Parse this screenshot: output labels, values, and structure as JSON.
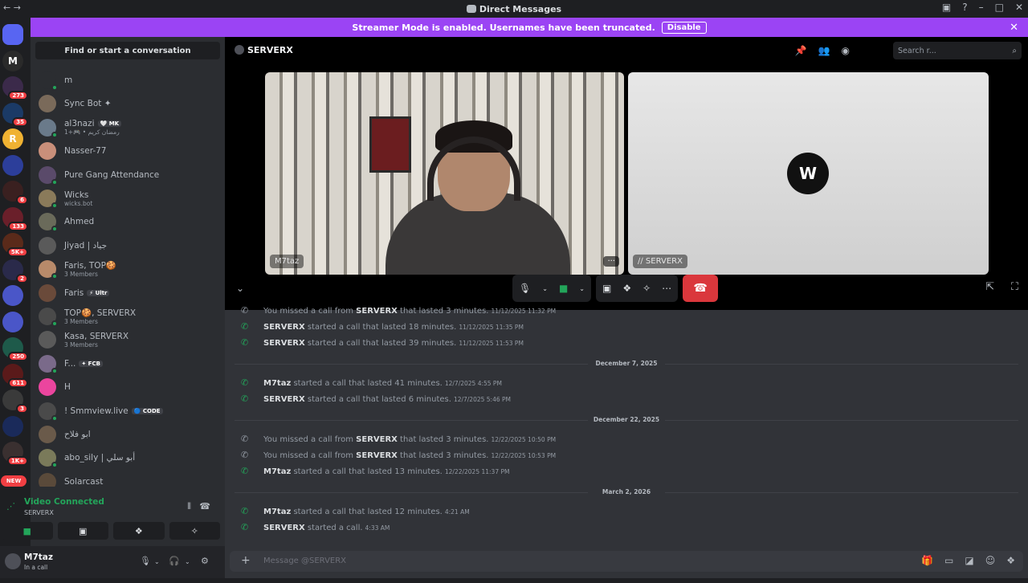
{
  "window": {
    "title": "Direct Messages",
    "nav_glyph": "← →",
    "controls": [
      "▣",
      "?",
      "–",
      "□",
      "✕"
    ]
  },
  "banner": {
    "text": "Streamer Mode is enabled. Usernames have been truncated.",
    "button": "Disable",
    "close": "✕"
  },
  "guilds": [
    {
      "glyph": "",
      "badge": "",
      "home": true
    },
    {
      "glyph": "M",
      "badge": ""
    },
    {
      "glyph": "",
      "badge": "273"
    },
    {
      "glyph": "",
      "badge": "35"
    },
    {
      "glyph": "R",
      "badge": ""
    },
    {
      "glyph": "",
      "badge": ""
    },
    {
      "glyph": "",
      "badge": "6"
    },
    {
      "glyph": "",
      "badge": "133"
    },
    {
      "glyph": "",
      "badge": "5K+"
    },
    {
      "glyph": "",
      "badge": "2"
    },
    {
      "glyph": "",
      "badge": ""
    },
    {
      "glyph": "",
      "badge": ""
    },
    {
      "glyph": "",
      "badge": "250"
    },
    {
      "glyph": "",
      "badge": "611"
    },
    {
      "glyph": "",
      "badge": "3"
    },
    {
      "glyph": "",
      "badge": ""
    },
    {
      "glyph": "",
      "badge": "1K+"
    }
  ],
  "guild_new_label": "NEW",
  "sidebar": {
    "find_label": "Find or start a conversation",
    "dms": [
      {
        "name": "m",
        "sub": "",
        "tag": ""
      },
      {
        "name": "Sync Bot ✦",
        "sub": "",
        "tag": ""
      },
      {
        "name": "al3nazi",
        "sub": "رمضان كريم • 🎮+1",
        "tag": "🤍 MK"
      },
      {
        "name": "Nasser-77",
        "sub": "",
        "tag": ""
      },
      {
        "name": "Pure Gang Attendance",
        "sub": "",
        "tag": ""
      },
      {
        "name": "Wicks",
        "sub": "wicks.bot",
        "tag": ""
      },
      {
        "name": "Ahmed",
        "sub": "",
        "tag": ""
      },
      {
        "name": "Jiyad | جياد",
        "sub": "",
        "tag": ""
      },
      {
        "name": "Faris, TOP🍪",
        "sub": "3 Members",
        "tag": ""
      },
      {
        "name": "Faris",
        "sub": "",
        "tag": "⚡ Ultr"
      },
      {
        "name": "TOP🍪, SERVERX",
        "sub": "3 Members",
        "tag": ""
      },
      {
        "name": "Kasa, SERVERX",
        "sub": "3 Members",
        "tag": ""
      },
      {
        "name": "F...",
        "sub": "",
        "tag": "✦ FCB"
      },
      {
        "name": "H",
        "sub": "",
        "tag": ""
      },
      {
        "name": "! Smmview.live",
        "sub": "",
        "tag": "🔵 CODE"
      },
      {
        "name": "ابو فلاح",
        "sub": "",
        "tag": ""
      },
      {
        "name": "abo_sily | أبو سلي",
        "sub": "",
        "tag": ""
      },
      {
        "name": "Solarcast",
        "sub": "",
        "tag": ""
      }
    ]
  },
  "voice": {
    "status": "Video Connected",
    "channel": "SERVERX",
    "buttons": [
      "■",
      "▣",
      "❖",
      "✧"
    ]
  },
  "user": {
    "name": "M7taz",
    "status": "In a call"
  },
  "call": {
    "header": "SERVERX",
    "search_placeholder": "Search r...",
    "left_name": "M7taz",
    "right_name": "∕∕ SERVERX",
    "more": "···"
  },
  "messages": [
    {
      "type": "missed",
      "pre": "You missed a call from ",
      "who": "SERVERX",
      "post": " that lasted 3 minutes.",
      "ts": "11/12/2025 11:32 PM"
    },
    {
      "type": "call",
      "pre": "",
      "who": "SERVERX",
      "post": " started a call that lasted 18 minutes.",
      "ts": "11/12/2025 11:35 PM"
    },
    {
      "type": "call",
      "pre": "",
      "who": "SERVERX",
      "post": " started a call that lasted 39 minutes.",
      "ts": "11/12/2025 11:53 PM"
    },
    {
      "type": "date",
      "label": "December 7, 2025"
    },
    {
      "type": "call",
      "pre": "",
      "who": "M7taz",
      "post": " started a call that lasted 41 minutes.",
      "ts": "12/7/2025 4:55 PM"
    },
    {
      "type": "call",
      "pre": "",
      "who": "SERVERX",
      "post": " started a call that lasted 6 minutes.",
      "ts": "12/7/2025 5:46 PM"
    },
    {
      "type": "date",
      "label": "December 22, 2025"
    },
    {
      "type": "missed",
      "pre": "You missed a call from ",
      "who": "SERVERX",
      "post": " that lasted 3 minutes.",
      "ts": "12/22/2025 10:50 PM"
    },
    {
      "type": "missed",
      "pre": "You missed a call from ",
      "who": "SERVERX",
      "post": " that lasted 3 minutes.",
      "ts": "12/22/2025 10:53 PM"
    },
    {
      "type": "call",
      "pre": "",
      "who": "M7taz",
      "post": " started a call that lasted 13 minutes.",
      "ts": "12/22/2025 11:37 PM"
    },
    {
      "type": "date",
      "label": "March 2, 2026"
    },
    {
      "type": "call",
      "pre": "",
      "who": "M7taz",
      "post": " started a call that lasted 12 minutes.",
      "ts": "4:21 AM"
    },
    {
      "type": "call",
      "pre": "",
      "who": "SERVERX",
      "post": " started a call.",
      "ts": "4:33 AM"
    }
  ],
  "composer": {
    "placeholder": "Message @SERVERX"
  },
  "colors": {
    "accent": "#5865f2",
    "online": "#23a55a",
    "danger": "#da373c",
    "banner": "#9b44f4"
  }
}
